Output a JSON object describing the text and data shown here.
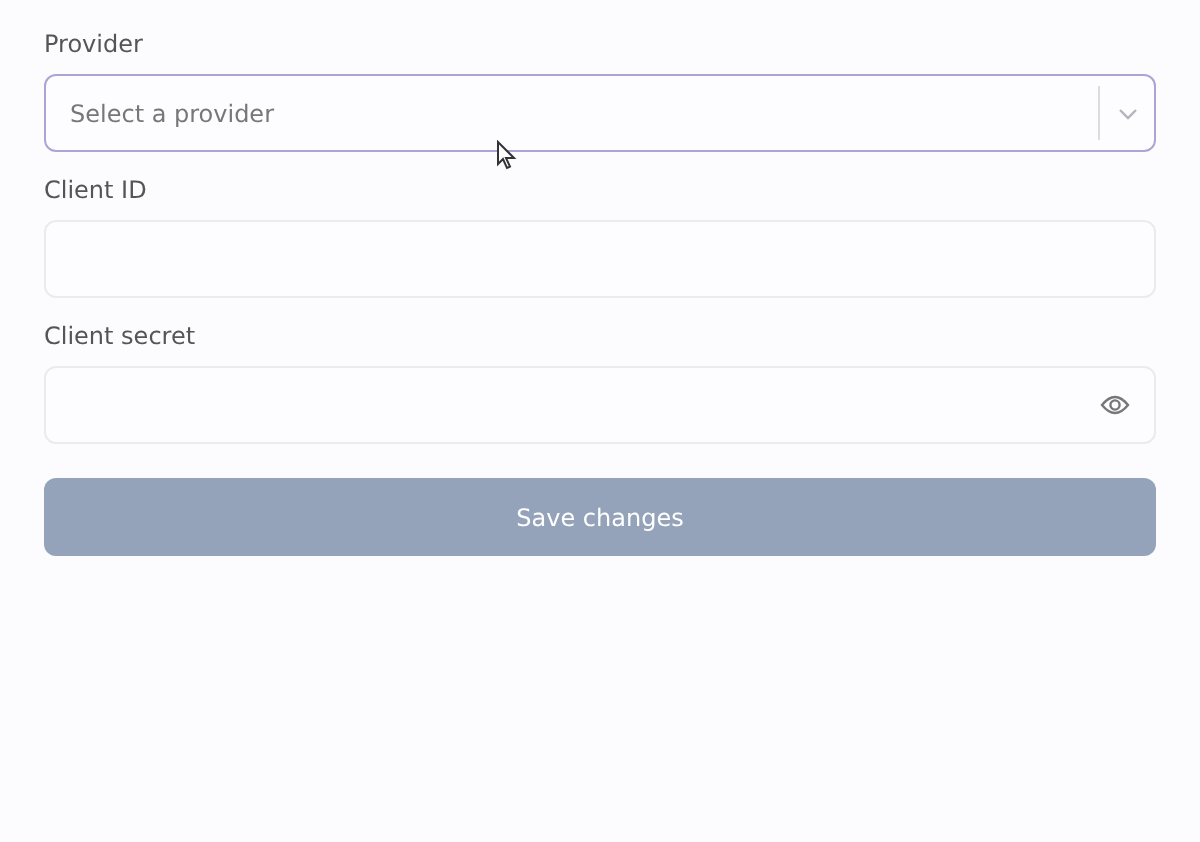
{
  "fields": [
    {
      "kind": "select",
      "label": "Provider",
      "placeholder": "Select a provider",
      "focused": true
    },
    {
      "kind": "text",
      "label": "Client ID",
      "focused": false
    },
    {
      "kind": "password",
      "label": "Client secret",
      "focused": false
    }
  ],
  "button": {
    "label": "Save changes",
    "disabled": true
  }
}
